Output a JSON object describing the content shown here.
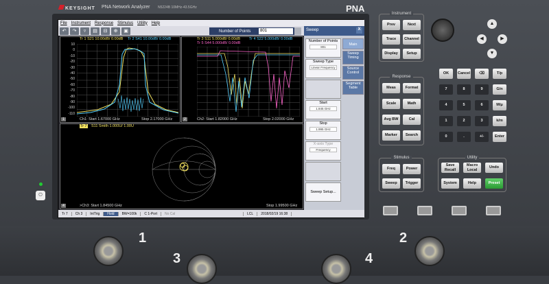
{
  "instrument": {
    "brand": "KEYSIGHT",
    "model": "PNA Network Analyzer",
    "model_no": "N5224B  10MHz-43.5GHz",
    "badge": "PNA"
  },
  "menu": [
    "File",
    "Instrument",
    "Response",
    "Stimulus",
    "Utility",
    "Help"
  ],
  "toolbar_icons": [
    "undo-icon",
    "redo-icon",
    "marker-icon",
    "table-icon",
    "zoom-out-icon",
    "zoom-in-icon",
    "screenshot-icon"
  ],
  "points": {
    "label": "Number of Points",
    "value": "801"
  },
  "sweep_dialog": {
    "title": "Sweep",
    "close": "X"
  },
  "win1": {
    "traces": [
      {
        "text": "Tr 1  S21 10.00dB/  0.00dB",
        "color": "#f0e060"
      },
      {
        "text": "Tr 2  S41 10.00dB/  0.00dB",
        "color": "#55d0ff"
      }
    ],
    "y_ticks": [
      "10",
      "0",
      "-10",
      "-20",
      "-30",
      "-40",
      "-50",
      "-60",
      "-70",
      "-80",
      "-90",
      "-100",
      "-110"
    ],
    "footer_start": "Ch1:  Start  1.67000 GHz",
    "footer_stop": "Stop  2.17000 GHz",
    "num": "1"
  },
  "win2": {
    "traces": [
      {
        "text": "Tr 3  S11 5.000dB/  0.00dB",
        "color": "#f0e060"
      },
      {
        "text": "Tr 4  S22 5.000dB/  0.00dB",
        "color": "#55d0ff"
      },
      {
        "text": "Tr 5  S44 5.000dB/  0.00dB",
        "color": "#ff66cc"
      }
    ],
    "footer_start": "Ch2:  Start  1.82000 GHz",
    "footer_stop": "Stop  2.02000 GHz",
    "num": "2"
  },
  "win3": {
    "tr": "Tr 7",
    "title": "S11 Smith 1.000U/  1.00U",
    "footer_start": ">Ch3:  Start  1.84500 GHz",
    "footer_stop": "Stop  1.99500 GHz",
    "num": "4"
  },
  "side_buttons": [
    {
      "label": "Number of Points",
      "sub": "801"
    },
    {
      "label": "Sweep Type",
      "sub": "Linear Frequency"
    },
    {
      "label": "",
      "sub": ""
    },
    {
      "label": "Start",
      "sub": "1.845 GHz"
    },
    {
      "label": "Stop",
      "sub": "1.995 GHz"
    },
    {
      "label": "X-axis Type",
      "sub": "Frequency"
    },
    {
      "label": "",
      "sub": ""
    },
    {
      "label": "Sweep Setup...",
      "sub": ""
    }
  ],
  "side_tabs": [
    "Main",
    "Sweep Timing",
    "Source Control",
    "Segment Table"
  ],
  "status": [
    "Tr 7",
    "Ch 3",
    "IntTrig",
    "Hold",
    "BW=100k",
    "C  1-Port",
    "No Cal",
    "LCL",
    "2018/02/19 16:38"
  ],
  "groups": {
    "instrument": "Instrument",
    "response": "Response",
    "stimulus": "Stimulus",
    "utility": "Utility"
  },
  "instrument_keys": [
    "Prev",
    "Next",
    "Trace",
    "Channel",
    "Display",
    "Setup"
  ],
  "response_keys": [
    "Meas",
    "Format",
    "Scale",
    "Math",
    "Avg BW",
    "Cal",
    "Marker",
    "Search"
  ],
  "numpad": [
    "OK",
    "Cancel",
    "⌫",
    "T/p",
    "7",
    "8",
    "9",
    "G/n",
    "4",
    "5",
    "6",
    "M/μ",
    "1",
    "2",
    "3",
    "k/m",
    "0",
    ".",
    "+/-",
    "Enter"
  ],
  "stimulus_keys": [
    "Freq",
    "Power",
    "Sweep",
    "Trigger"
  ],
  "utility_keys": [
    "Save Recall",
    "Macro Local",
    "Undo",
    "System",
    "Help",
    "Preset"
  ],
  "ports": [
    "1",
    "2",
    "3",
    "4"
  ]
}
